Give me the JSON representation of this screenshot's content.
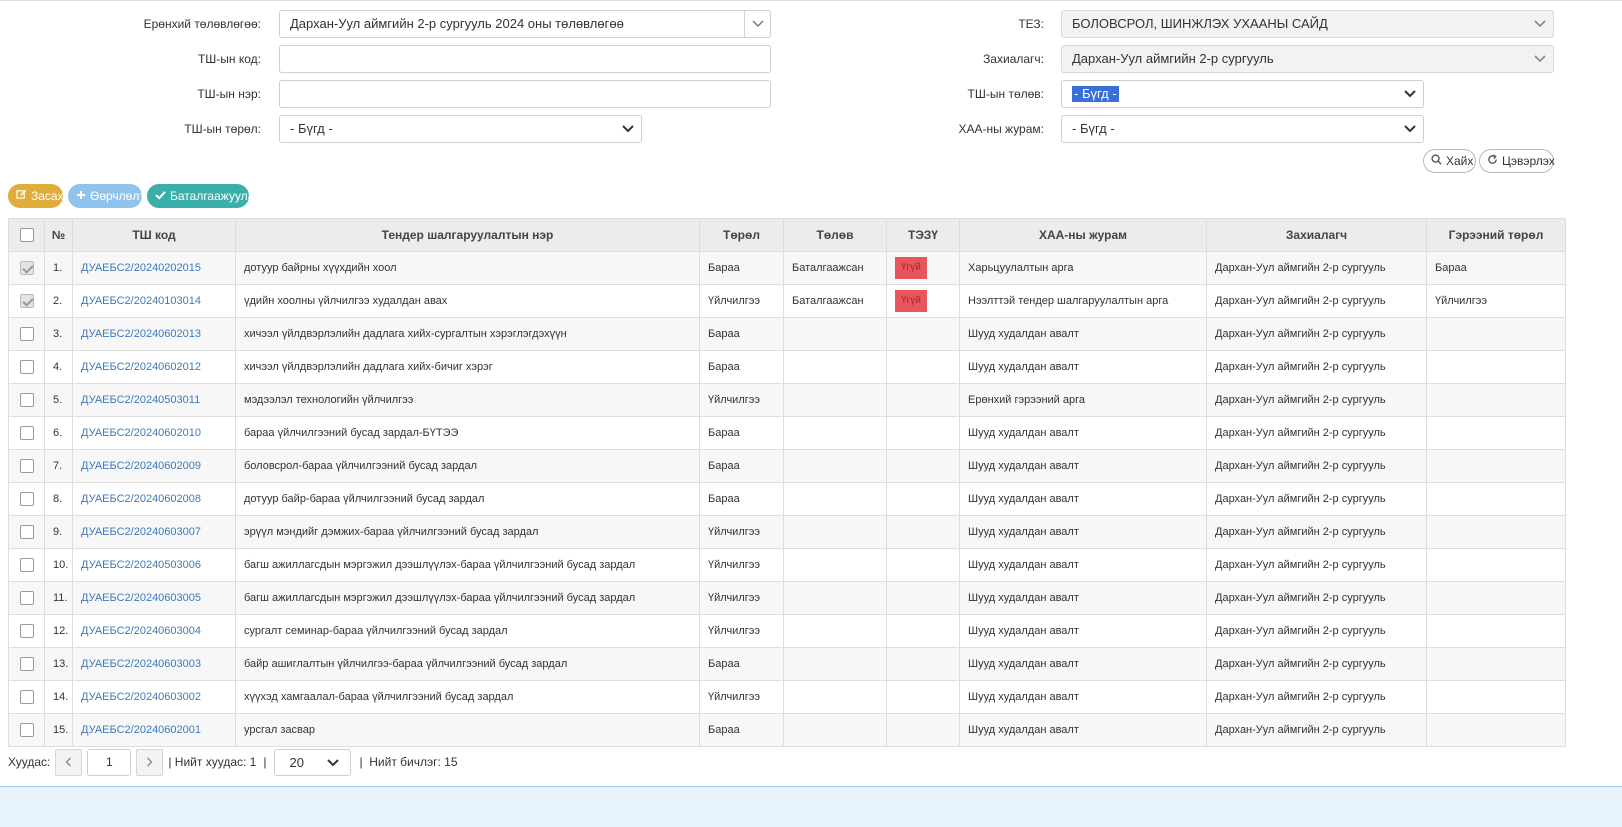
{
  "filters": {
    "plan_label": "Ерөнхий төлөвлөгөө:",
    "plan_value": "Дархан-Уул аймгийн 2-р сургууль 2024 оны төлөвлөгөө",
    "tsh_code_label": "ТШ-ын код:",
    "tsh_code_value": "",
    "tsh_name_label": "ТШ-ын нэр:",
    "tsh_name_value": "",
    "tsh_type_label": "ТШ-ын төрөл:",
    "tsh_type_value": "- Бүгд -",
    "tez_label": "ТЕЗ:",
    "tez_value": "БОЛОВСРОЛ, ШИНЖЛЭХ УХААНЫ САЙД",
    "customer_label": "Захиалагч:",
    "customer_value": "Дархан-Уул аймгийн 2-р сургууль",
    "tsh_status_label": "ТШ-ын төлөв:",
    "tsh_status_value": "- Бүгд -",
    "procedure_label": "ХАА-ны журам:",
    "procedure_value": "- Бүгд -",
    "search_label": "Хайх",
    "clear_label": "Цэвэрлэх"
  },
  "actions": {
    "edit_label": "Засах",
    "transfer_label": "Өөрчлөлт",
    "confirm_label": "Баталгаажуулах"
  },
  "table": {
    "headers": [
      "№",
      "ТШ код",
      "Тендер шалгаруулалтын нэр",
      "Төрөл",
      "Төлөв",
      "ТЭЗҮ",
      "ХАА-ны журам",
      "Захиалагч",
      "Гэрээний төрөл"
    ],
    "rows": [
      {
        "checked": true,
        "no": "1.",
        "code": "ДУАЕБС2/20240202015",
        "name": "дотуур байрны хүүхдийн хоол",
        "type": "Бараа",
        "status": "Баталгаажсан",
        "tezu": "Үгүй",
        "procedure": "Харьцуулалтын арга",
        "customer": "Дархан-Уул аймгийн 2-р сургууль",
        "contract": "Бараа"
      },
      {
        "checked": true,
        "no": "2.",
        "code": "ДУАЕБС2/20240103014",
        "name": "үдийн хоолны үйлчилгээ худалдан авах",
        "type": "Үйлчилгээ",
        "status": "Баталгаажсан",
        "tezu": "Үгүй",
        "procedure": "Нээлттэй тендер шалгаруулалтын арга",
        "customer": "Дархан-Уул аймгийн 2-р сургууль",
        "contract": "Үйлчилгээ"
      },
      {
        "checked": false,
        "no": "3.",
        "code": "ДУАЕБС2/20240602013",
        "name": "хичээл үйлдвэрлэлийн дадлага хийх-сургалтын хэрэглэгдэхүүн",
        "type": "Бараа",
        "status": "",
        "tezu": "",
        "procedure": "Шууд худалдан авалт",
        "customer": "Дархан-Уул аймгийн 2-р сургууль",
        "contract": ""
      },
      {
        "checked": false,
        "no": "4.",
        "code": "ДУАЕБС2/20240602012",
        "name": "хичээл үйлдвэрлэлийн дадлага хийх-бичиг хэрэг",
        "type": "Бараа",
        "status": "",
        "tezu": "",
        "procedure": "Шууд худалдан авалт",
        "customer": "Дархан-Уул аймгийн 2-р сургууль",
        "contract": ""
      },
      {
        "checked": false,
        "no": "5.",
        "code": "ДУАЕБС2/20240503011",
        "name": "мэдээлэл технологийн үйлчилгээ",
        "type": "Үйлчилгээ",
        "status": "",
        "tezu": "",
        "procedure": "Ерөнхий гэрээний арга",
        "customer": "Дархан-Уул аймгийн 2-р сургууль",
        "contract": ""
      },
      {
        "checked": false,
        "no": "6.",
        "code": "ДУАЕБС2/20240602010",
        "name": "бараа үйлчилгээний бусад зардал-БҮТЭЭ",
        "type": "Бараа",
        "status": "",
        "tezu": "",
        "procedure": "Шууд худалдан авалт",
        "customer": "Дархан-Уул аймгийн 2-р сургууль",
        "contract": ""
      },
      {
        "checked": false,
        "no": "7.",
        "code": "ДУАЕБС2/20240602009",
        "name": "боловсрол-бараа үйлчилгээний бусад зардал",
        "type": "Бараа",
        "status": "",
        "tezu": "",
        "procedure": "Шууд худалдан авалт",
        "customer": "Дархан-Уул аймгийн 2-р сургууль",
        "contract": ""
      },
      {
        "checked": false,
        "no": "8.",
        "code": "ДУАЕБС2/20240602008",
        "name": "дотуур байр-бараа үйлчилгээний бусад зардал",
        "type": "Бараа",
        "status": "",
        "tezu": "",
        "procedure": "Шууд худалдан авалт",
        "customer": "Дархан-Уул аймгийн 2-р сургууль",
        "contract": ""
      },
      {
        "checked": false,
        "no": "9.",
        "code": "ДУАЕБС2/20240603007",
        "name": "эрүүл мэндийг дэмжих-бараа үйлчилгээний бусад зардал",
        "type": "Үйлчилгээ",
        "status": "",
        "tezu": "",
        "procedure": "Шууд худалдан авалт",
        "customer": "Дархан-Уул аймгийн 2-р сургууль",
        "contract": ""
      },
      {
        "checked": false,
        "no": "10.",
        "code": "ДУАЕБС2/20240503006",
        "name": "багш ажиллагсдын мэргэжил дээшлүүлэх-бараа үйлчилгээний бусад зардал",
        "type": "Үйлчилгээ",
        "status": "",
        "tezu": "",
        "procedure": "Шууд худалдан авалт",
        "customer": "Дархан-Уул аймгийн 2-р сургууль",
        "contract": ""
      },
      {
        "checked": false,
        "no": "11.",
        "code": "ДУАЕБС2/20240603005",
        "name": "багш ажиллагсдын мэргэжил дээшлүүлэх-бараа үйлчилгээний бусад зардал",
        "type": "Үйлчилгээ",
        "status": "",
        "tezu": "",
        "procedure": "Шууд худалдан авалт",
        "customer": "Дархан-Уул аймгийн 2-р сургууль",
        "contract": ""
      },
      {
        "checked": false,
        "no": "12.",
        "code": "ДУАЕБС2/20240603004",
        "name": "сургалт семинар-бараа үйлчилгээний бусад зардал",
        "type": "Үйлчилгээ",
        "status": "",
        "tezu": "",
        "procedure": "Шууд худалдан авалт",
        "customer": "Дархан-Уул аймгийн 2-р сургууль",
        "contract": ""
      },
      {
        "checked": false,
        "no": "13.",
        "code": "ДУАЕБС2/20240603003",
        "name": "байр ашиглалтын үйлчилгээ-бараа үйлчилгээний бусад зардал",
        "type": "Бараа",
        "status": "",
        "tezu": "",
        "procedure": "Шууд худалдан авалт",
        "customer": "Дархан-Уул аймгийн 2-р сургууль",
        "contract": ""
      },
      {
        "checked": false,
        "no": "14.",
        "code": "ДУАЕБС2/20240603002",
        "name": "хүүхэд хамгаалал-бараа үйлчилгээний бусад зардал",
        "type": "Үйлчилгээ",
        "status": "",
        "tezu": "",
        "procedure": "Шууд худалдан авалт",
        "customer": "Дархан-Уул аймгийн 2-р сургууль",
        "contract": ""
      },
      {
        "checked": false,
        "no": "15.",
        "code": "ДУАЕБС2/20240602001",
        "name": "урсгал засвар",
        "type": "Бараа",
        "status": "",
        "tezu": "",
        "procedure": "Шууд худалдан авалт",
        "customer": "Дархан-Уул аймгийн 2-р сургууль",
        "contract": ""
      }
    ]
  },
  "pager": {
    "page_label": "Хуудас:",
    "current_page": "1",
    "total_pages_label": "| Нийт хуудас: 1",
    "separator": "|",
    "page_size": "20",
    "total_records_label": "|  Нийт бичлэг: 15"
  },
  "colors": {
    "edit": "#e0ac3a",
    "transfer": "#8fc3ec",
    "confirm": "#3aafa9",
    "badge": "#e8555d",
    "link": "#3d7ab8",
    "highlight": "#3a6fd8"
  },
  "icons": {
    "edit": "pencil-square-icon",
    "transfer": "plus-icon",
    "confirm": "check-icon",
    "search": "search-icon",
    "clear": "refresh-icon",
    "select": "chevron-down-icon"
  }
}
